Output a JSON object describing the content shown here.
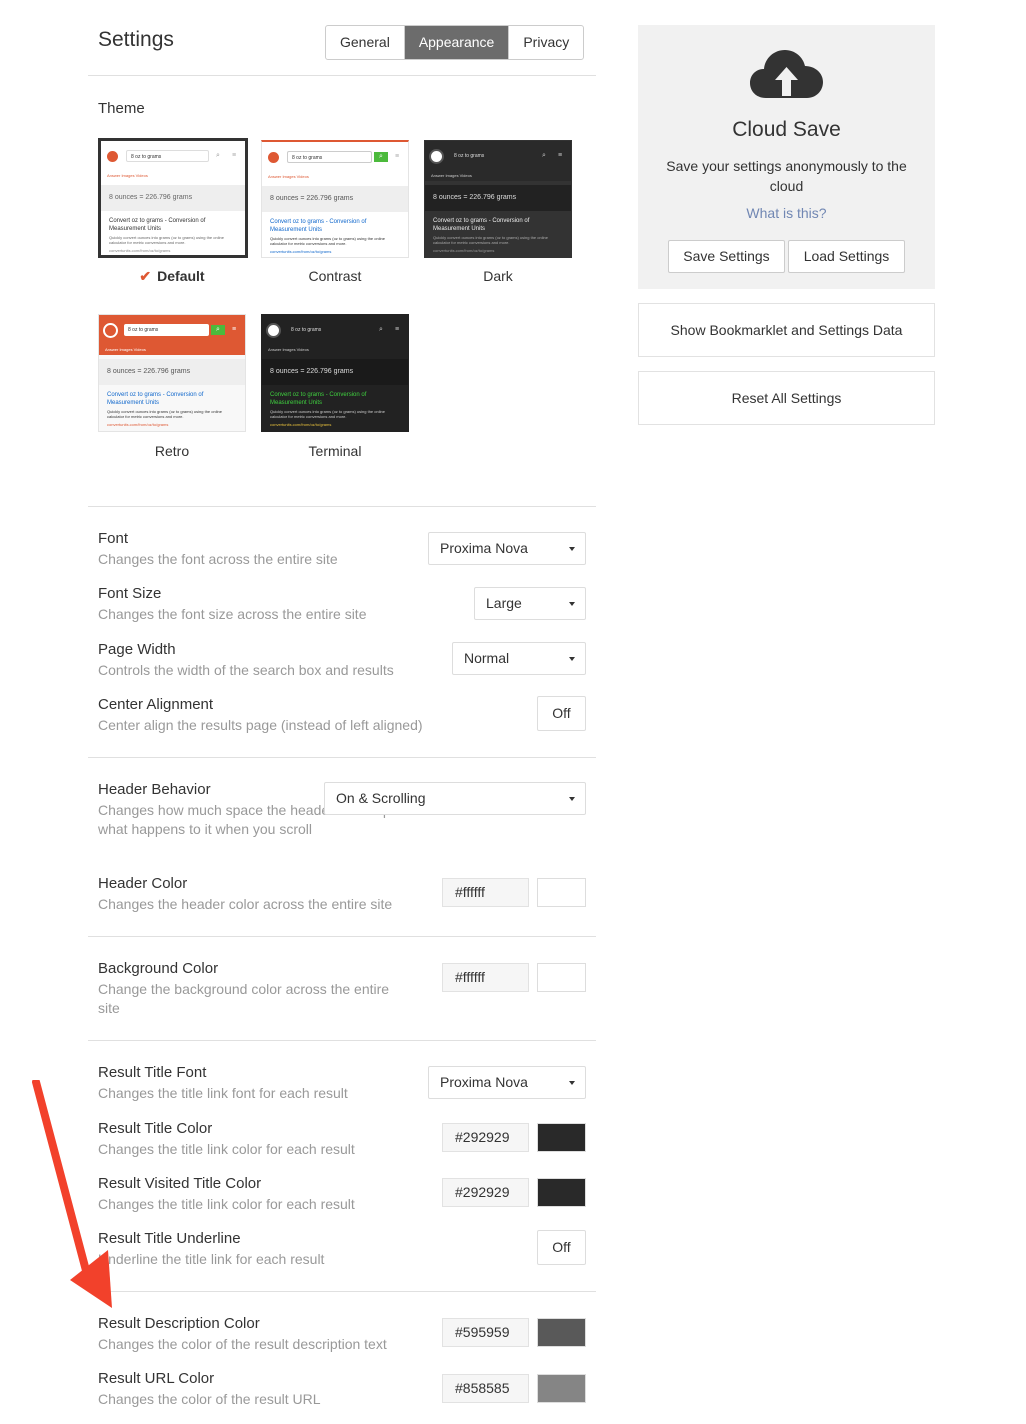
{
  "header": {
    "title": "Settings",
    "tabs": [
      {
        "label": "General",
        "active": false
      },
      {
        "label": "Appearance",
        "active": true
      },
      {
        "label": "Privacy",
        "active": false
      }
    ]
  },
  "theme": {
    "label": "Theme",
    "query": "8 oz to grams",
    "search_tabs": "Answer    Images    Videos",
    "answer": "8 ounces = 226.796 grams",
    "result_title": "Convert oz to grams - Conversion of Measurement Units",
    "result_desc": "Quickly convert ounces into grams (oz to grams) using the online calculator for metric conversions and more.",
    "result_url": "convertunits.com/from/oz/to/grams",
    "check": "✔",
    "items": [
      {
        "name": "Default",
        "selected": true
      },
      {
        "name": "Contrast",
        "selected": false
      },
      {
        "name": "Dark",
        "selected": false
      },
      {
        "name": "Retro",
        "selected": false
      },
      {
        "name": "Terminal",
        "selected": false
      }
    ]
  },
  "settings": {
    "font": {
      "title": "Font",
      "desc": "Changes the font across the entire site",
      "value": "Proxima Nova"
    },
    "font_size": {
      "title": "Font Size",
      "desc": "Changes the font size across the entire site",
      "value": "Large"
    },
    "page_width": {
      "title": "Page Width",
      "desc": "Controls the width of the search box and results",
      "value": "Normal"
    },
    "center_alignment": {
      "title": "Center Alignment",
      "desc": "Center align the results page (instead of left aligned)",
      "value": "Off"
    },
    "header_behavior": {
      "title": "Header Behavior",
      "desc": "Changes how much space the header takes up and what happens to it when you scroll",
      "value": "On & Scrolling"
    },
    "header_color": {
      "title": "Header Color",
      "desc": "Changes the header color across the entire site",
      "value": "#ffffff"
    },
    "background_color": {
      "title": "Background Color",
      "desc": "Change the background color across the entire site",
      "value": "#ffffff"
    },
    "result_title_font": {
      "title": "Result Title Font",
      "desc": "Changes the title link font for each result",
      "value": "Proxima Nova"
    },
    "result_title_color": {
      "title": "Result Title Color",
      "desc": "Changes the title link color for each result",
      "value": "#292929"
    },
    "result_visited_title_color": {
      "title": "Result Visited Title Color",
      "desc": "Changes the title link color for each result",
      "value": "#292929"
    },
    "result_title_underline": {
      "title": "Result Title Underline",
      "desc": "Underline the title link for each result",
      "value": "Off"
    },
    "result_description_color": {
      "title": "Result Description Color",
      "desc": "Changes the color of the result description text",
      "value": "#595959"
    },
    "result_url_color": {
      "title": "Result URL Color",
      "desc": "Changes the color of the result URL",
      "value": "#858585"
    }
  },
  "cloud_save": {
    "icon": "cloud-upload-icon",
    "title": "Cloud Save",
    "desc": "Save your settings anonymously to the cloud",
    "link": "What is this?",
    "save_label": "Save Settings",
    "load_label": "Load Settings"
  },
  "panel": {
    "bookmarklet_label": "Show Bookmarklet and Settings Data",
    "reset_label": "Reset All Settings"
  },
  "colors": {
    "accent": "#de5833",
    "link": "#7187b3",
    "active_tab": "#6c6c6c"
  }
}
